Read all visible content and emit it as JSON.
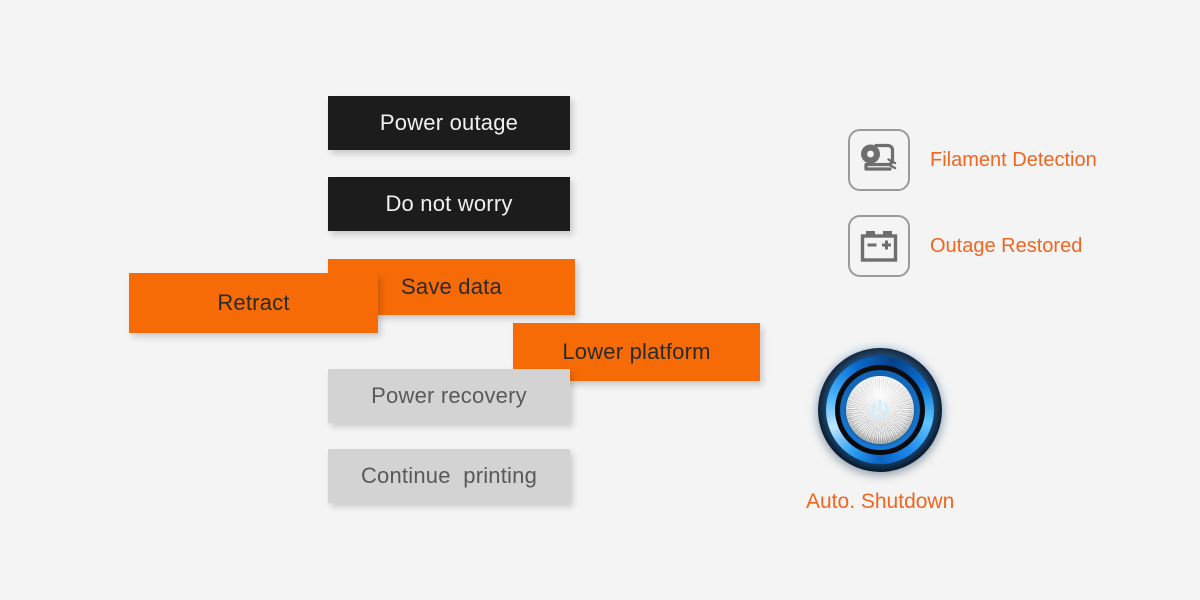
{
  "background_color": "#f4f4f4",
  "colors": {
    "orange_bar": "#f76b07",
    "dark_bar": "#1c1c1c",
    "gray_bar": "#d3d3d3",
    "orange_text": "#f2651f",
    "icon_stroke": "#6e6e6e"
  },
  "flow": {
    "steps": [
      {
        "label": "Power outage",
        "style": "dark"
      },
      {
        "label": "Do not worry",
        "style": "dark"
      },
      {
        "label": "Retract",
        "style": "orange"
      },
      {
        "label": "Save data",
        "style": "orange"
      },
      {
        "label": "Lower platform",
        "style": "orange"
      },
      {
        "label": "Power recovery",
        "style": "gray"
      },
      {
        "label": "Continue  printing",
        "style": "gray"
      }
    ]
  },
  "features": [
    {
      "label": "Filament Detection",
      "icon": "filament-spool-icon"
    },
    {
      "label": "Outage Restored",
      "icon": "battery-icon"
    }
  ],
  "power": {
    "caption": "Auto. Shutdown",
    "icon": "power-icon"
  }
}
